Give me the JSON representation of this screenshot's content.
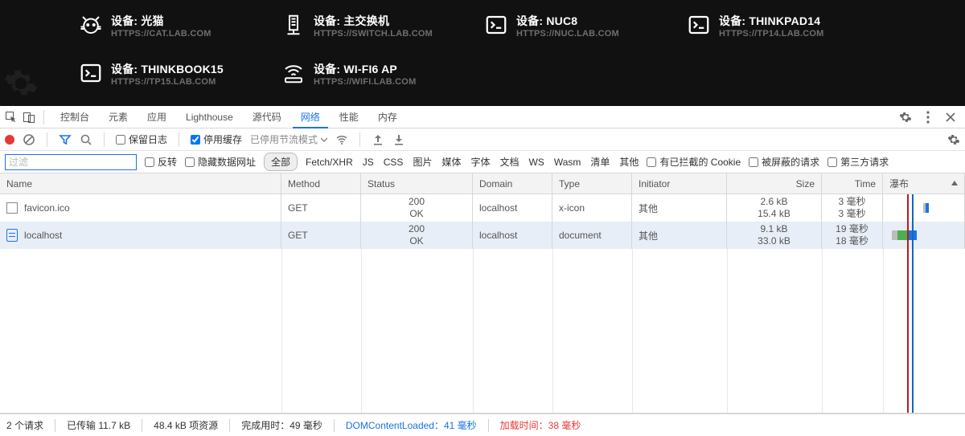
{
  "hero": {
    "cards": [
      {
        "icon": "cat",
        "title": "设备: 光猫",
        "sub": "HTTPS://CAT.LAB.COM"
      },
      {
        "icon": "switch",
        "title": "设备: 主交换机",
        "sub": "HTTPS://SWITCH.LAB.COM"
      },
      {
        "icon": "terminal",
        "title": "设备: NUC8",
        "sub": "HTTPS://NUC.LAB.COM"
      },
      {
        "icon": "terminal",
        "title": "设备: THINKPAD14",
        "sub": "HTTPS://TP14.LAB.COM"
      },
      {
        "icon": "terminal",
        "title": "设备: THINKBOOK15",
        "sub": "HTTPS://TP15.LAB.COM"
      },
      {
        "icon": "wifi",
        "title": "设备: WI-FI6 AP",
        "sub": "HTTPS://WIFI.LAB.COM"
      }
    ]
  },
  "devtools": {
    "panels": {
      "console": "控制台",
      "elements": "元素",
      "application": "应用",
      "lighthouse": "Lighthouse",
      "sources": "源代码",
      "network": "网络",
      "performance": "性能",
      "memory": "内存"
    },
    "active_panel": "network",
    "netbar": {
      "preserve_log": {
        "label": "保留日志",
        "checked": false
      },
      "disable_cache": {
        "label": "停用缓存",
        "checked": true
      },
      "throttling": "已停用节流模式"
    },
    "filter": {
      "placeholder": "过滤",
      "invert": {
        "label": "反转",
        "checked": false
      },
      "hide_data": {
        "label": "隐藏数据网址",
        "checked": false
      },
      "types": {
        "all": "全部",
        "fetch": "Fetch/XHR",
        "js": "JS",
        "css": "CSS",
        "img": "图片",
        "media": "媒体",
        "font": "字体",
        "doc": "文档",
        "ws": "WS",
        "wasm": "Wasm",
        "manifest": "清单",
        "other": "其他"
      },
      "blocked_cookies": {
        "label": "有已拦截的 Cookie",
        "checked": false
      },
      "blocked_reqs": {
        "label": "被屏蔽的请求",
        "checked": false
      },
      "third_party": {
        "label": "第三方请求",
        "checked": false
      }
    },
    "table": {
      "headers": {
        "name": "Name",
        "method": "Method",
        "status": "Status",
        "domain": "Domain",
        "type": "Type",
        "initiator": "Initiator",
        "size": "Size",
        "time": "Time",
        "waterfall": "瀑布"
      },
      "rows": [
        {
          "name": "localhost",
          "icon": "document",
          "method": "GET",
          "status_code": "200",
          "status_text": "OK",
          "domain": "localhost",
          "type": "document",
          "initiator": "其他",
          "size_top": "9.1 kB",
          "size_bottom": "33.0 kB",
          "time_top": "19 毫秒",
          "time_bottom": "18 毫秒",
          "wf": {
            "left_pct": 4,
            "segs": [
              {
                "w": 8,
                "c": "#bdbdbd"
              },
              {
                "w": 16,
                "c": "#4caf50"
              },
              {
                "w": 10,
                "c": "#1a73e8"
              }
            ]
          },
          "selected": true
        },
        {
          "name": "favicon.ico",
          "icon": "favicon",
          "method": "GET",
          "status_code": "200",
          "status_text": "OK",
          "domain": "localhost",
          "type": "x-icon",
          "initiator": "其他",
          "size_top": "2.6 kB",
          "size_bottom": "15.4 kB",
          "time_top": "3 毫秒",
          "time_bottom": "3 毫秒",
          "wf": {
            "left_pct": 49,
            "segs": [
              {
                "w": 4,
                "c": "#bdbdbd"
              },
              {
                "w": 4,
                "c": "#1a73e8"
              }
            ]
          },
          "selected": false
        }
      ]
    },
    "status": {
      "requests": "2 个请求",
      "transferred": "已传输 11.7 kB",
      "resources": "48.4 kB 项资源",
      "finish_label": "完成用时：",
      "finish_value": "49 毫秒",
      "dcl_label": "DOMContentLoaded：",
      "dcl_value": "41 毫秒",
      "load_label": "加载时间：",
      "load_value": "38 毫秒"
    }
  }
}
